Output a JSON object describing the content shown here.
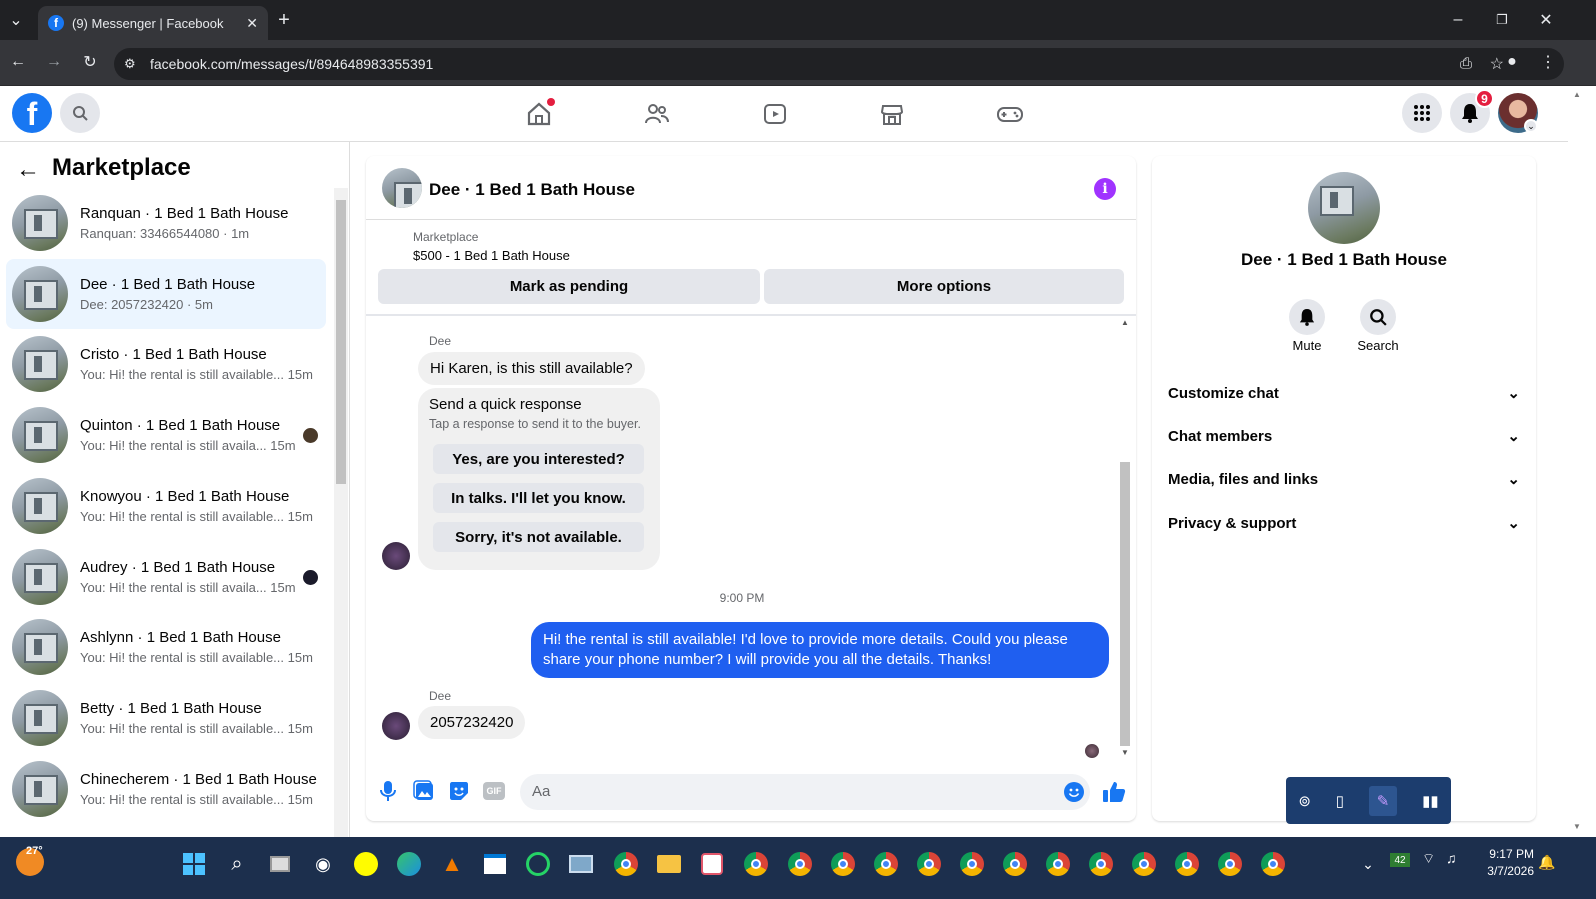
{
  "browser": {
    "tab_title": "(9) Messenger | Facebook",
    "url": "facebook.com/messages/t/894648983355391"
  },
  "header": {
    "notification_count": "9"
  },
  "sidebar": {
    "title": "Marketplace",
    "conversations": [
      {
        "name": "Ranquan · 1 Bed 1 Bath House",
        "preview": "Ranquan: 33466544080 · 1m"
      },
      {
        "name": "Dee · 1 Bed 1 Bath House",
        "preview": "Dee: 2057232420 · 5m"
      },
      {
        "name": "Cristo · 1 Bed 1 Bath House",
        "preview": "You: Hi! the rental is still available... 15m"
      },
      {
        "name": "Quinton · 1 Bed 1 Bath House",
        "preview": "You: Hi! the rental is still availa... 15m"
      },
      {
        "name": "Knowyou · 1 Bed 1 Bath House",
        "preview": "You: Hi! the rental is still available... 15m"
      },
      {
        "name": "Audrey · 1 Bed 1 Bath House",
        "preview": "You: Hi! the rental is still availa... 15m"
      },
      {
        "name": "Ashlynn · 1 Bed 1 Bath House",
        "preview": "You: Hi! the rental is still available... 15m"
      },
      {
        "name": "Betty · 1 Bed 1 Bath House",
        "preview": "You: Hi! the rental is still available... 15m"
      },
      {
        "name": "Chinecherem · 1 Bed 1 Bath House",
        "preview": "You: Hi! the rental is still available... 15m"
      }
    ]
  },
  "chat": {
    "title": "Dee · 1 Bed 1 Bath House",
    "listing_label": "Marketplace",
    "listing_price": "$500 - 1 Bed 1 Bath House",
    "mark_pending": "Mark as pending",
    "more_options": "More options",
    "sender1": "Dee",
    "msg1": "Hi Karen, is this still available?",
    "quick_title": "Send a quick response",
    "quick_sub": "Tap a response to send it to the buyer.",
    "quick_options": [
      "Yes, are you interested?",
      "In talks. I'll let you know.",
      "Sorry, it's not available."
    ],
    "timestamp": "9:00 PM",
    "my_msg": "Hi! the rental is still available! I'd love to provide more details. Could you please share your phone number? I will provide you all the details. Thanks!",
    "sender2": "Dee",
    "msg2": "2057232420",
    "composer_placeholder": "Aa"
  },
  "info": {
    "title": "Dee · 1 Bed 1 Bath House",
    "mute": "Mute",
    "search": "Search",
    "sections": [
      "Customize chat",
      "Chat members",
      "Media, files and links",
      "Privacy & support"
    ]
  },
  "taskbar": {
    "weather": "27°",
    "battery": "42",
    "time": "9:17 PM",
    "date": "3/7/2026"
  },
  "colors": {
    "fb_blue": "#1877f2",
    "my_bubble": "#1f5ff0",
    "info_purple": "#a033ff"
  }
}
